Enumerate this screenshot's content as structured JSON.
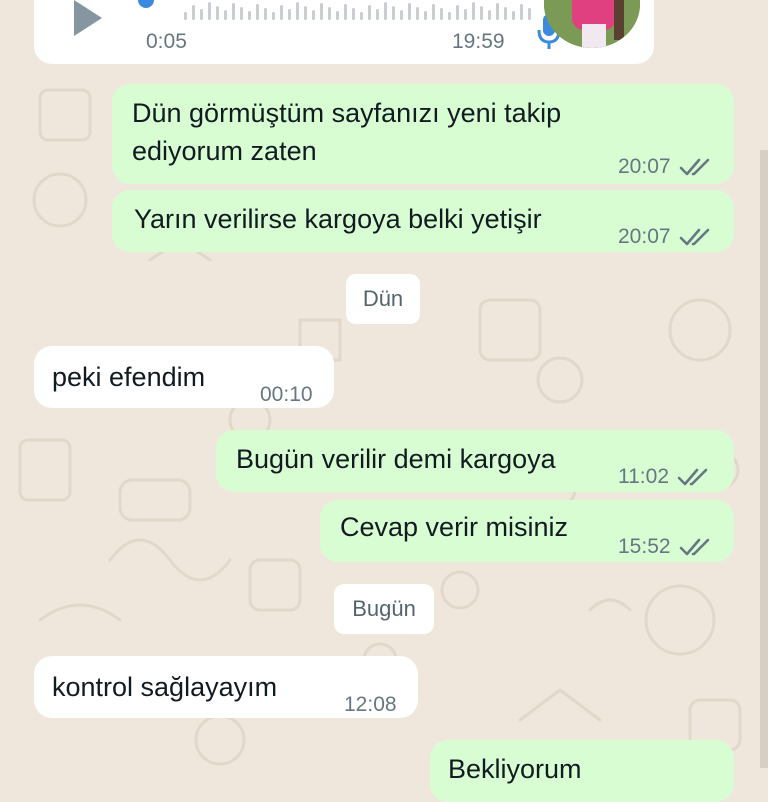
{
  "voice_message": {
    "duration": "0:05",
    "time": "19:59",
    "play_icon": "play-icon",
    "mic_icon": "mic-icon"
  },
  "messages": [
    {
      "direction": "out",
      "text_line1": "Dün görmüştüm sayfanızı yeni takip",
      "text_line2": "ediyorum zaten",
      "time": "20:07",
      "status": "read"
    },
    {
      "direction": "out",
      "text": "Yarın verilirse kargoya belki yetişir",
      "time": "20:07",
      "status": "read"
    },
    {
      "direction": "in",
      "text": "peki efendim",
      "time": "00:10"
    },
    {
      "direction": "out",
      "text": "Bugün verilir demi kargoya",
      "time": "11:02",
      "status": "read"
    },
    {
      "direction": "out",
      "text": "Cevap verir misiniz",
      "time": "15:52",
      "status": "read"
    },
    {
      "direction": "in",
      "text": "kontrol sağlayayım",
      "time": "12:08"
    },
    {
      "direction": "out",
      "text": "Bekliyorum",
      "time": ""
    }
  ],
  "date_separators": {
    "yesterday": "Dün",
    "today": "Bugün"
  },
  "colors": {
    "background": "#efe7dc",
    "outgoing_bubble": "#d9fdd3",
    "incoming_bubble": "#ffffff",
    "meta_text": "#667781",
    "read_ticks": "#667781",
    "accent": "#3b8ae0"
  }
}
